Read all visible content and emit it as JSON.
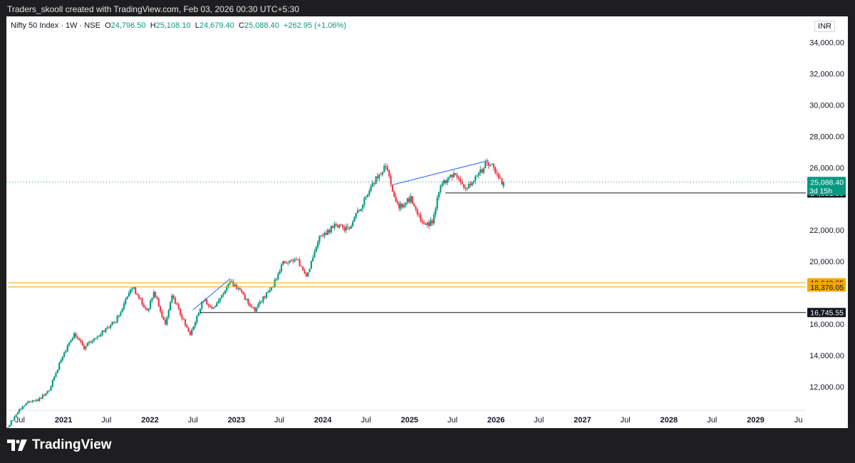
{
  "caption": "Traders_skooll created with TradingView.com, Feb 03, 2026 00:30 UTC+5:30",
  "legend": {
    "symbol": "Nifty 50 Index · 1W · NSE",
    "open_key": "O",
    "open": "24,796.50",
    "high_key": "H",
    "high": "25,108.10",
    "low_key": "L",
    "low": "24,679.40",
    "close_key": "C",
    "close": "25,088.40",
    "change": "+262.95 (+1.06%)"
  },
  "currency": "INR",
  "brand": {
    "name": "TradingView",
    "icon": "tradingview-logo-icon"
  },
  "colors": {
    "up": "#089981",
    "down": "#f23645",
    "trendline": "#2962ff",
    "level_orange": "#f7a600",
    "level_black": "#131722",
    "price_badge": "#089981"
  },
  "chart_data": {
    "type": "candlestick",
    "title": "Nifty 50 Index · 1W · NSE",
    "ylabel": "INR",
    "ylim": [
      10500,
      35200
    ],
    "xlim": [
      "2020-05-11",
      "2029-08-01"
    ],
    "y_ticks": [
      "34,000.00",
      "32,000.00",
      "30,000.00",
      "28,000.00",
      "26,000.00",
      "22,000.00",
      "20,000.00",
      "16,000.00",
      "14,000.00",
      "12,000.00"
    ],
    "y_tick_values": [
      34000,
      32000,
      30000,
      28000,
      26000,
      22000,
      20000,
      16000,
      14000,
      12000
    ],
    "x_ticks": [
      {
        "label": "Jul",
        "date": "2020-07-01",
        "bold": false
      },
      {
        "label": "2021",
        "date": "2021-01-01",
        "bold": true
      },
      {
        "label": "Jul",
        "date": "2021-07-01",
        "bold": false
      },
      {
        "label": "2022",
        "date": "2022-01-01",
        "bold": true
      },
      {
        "label": "Jul",
        "date": "2022-07-01",
        "bold": false
      },
      {
        "label": "2023",
        "date": "2023-01-01",
        "bold": true
      },
      {
        "label": "Jul",
        "date": "2023-07-01",
        "bold": false
      },
      {
        "label": "2024",
        "date": "2024-01-01",
        "bold": true
      },
      {
        "label": "Jul",
        "date": "2024-07-01",
        "bold": false
      },
      {
        "label": "2025",
        "date": "2025-01-01",
        "bold": true
      },
      {
        "label": "Jul",
        "date": "2025-07-01",
        "bold": false
      },
      {
        "label": "2026",
        "date": "2026-01-01",
        "bold": true
      },
      {
        "label": "Jul",
        "date": "2026-07-01",
        "bold": false
      },
      {
        "label": "2027",
        "date": "2027-01-01",
        "bold": true
      },
      {
        "label": "Jul",
        "date": "2027-07-01",
        "bold": false
      },
      {
        "label": "2028",
        "date": "2028-01-01",
        "bold": true
      },
      {
        "label": "Jul",
        "date": "2028-07-01",
        "bold": false
      },
      {
        "label": "2029",
        "date": "2029-01-01",
        "bold": true
      },
      {
        "label": "Ju",
        "date": "2029-07-01",
        "bold": false
      }
    ],
    "last_price": {
      "value": 25088.4,
      "label": "25,088.40",
      "countdown": "3d 15h"
    },
    "levels": [
      {
        "value": 24381.5,
        "label": "24,381.50",
        "color": "#131722",
        "from": "2025-06-01"
      },
      {
        "value": 18640.65,
        "label": "18,640.65",
        "color": "#f7a600",
        "from": "2020-05-11"
      },
      {
        "value": 18376.05,
        "label": "18,376.05",
        "color": "#f7a600",
        "from": "2020-05-11"
      },
      {
        "value": 16745.55,
        "label": "16,745.55",
        "color": "#131722",
        "from": "2022-08-01"
      }
    ],
    "trendlines": [
      {
        "from": [
          "2022-07-01",
          16900
        ],
        "to": [
          "2022-12-05",
          18900
        ]
      },
      {
        "from": [
          "2024-10-21",
          24900
        ],
        "to": [
          "2025-12-01",
          26450
        ]
      }
    ],
    "anchors": [
      [
        "2020-05-11",
        9400
      ],
      [
        "2020-06-15",
        10300
      ],
      [
        "2020-08-03",
        11000
      ],
      [
        "2020-09-21",
        11200
      ],
      [
        "2020-11-02",
        11800
      ],
      [
        "2020-12-28",
        14000
      ],
      [
        "2021-02-15",
        15300
      ],
      [
        "2021-03-29",
        14500
      ],
      [
        "2021-05-10",
        15000
      ],
      [
        "2021-06-28",
        15700
      ],
      [
        "2021-08-09",
        16200
      ],
      [
        "2021-10-18",
        18400
      ],
      [
        "2021-12-20",
        16800
      ],
      [
        "2022-01-17",
        18100
      ],
      [
        "2022-03-07",
        16000
      ],
      [
        "2022-04-04",
        17800
      ],
      [
        "2022-06-20",
        15300
      ],
      [
        "2022-08-15",
        17600
      ],
      [
        "2022-09-26",
        17000
      ],
      [
        "2022-12-05",
        18800
      ],
      [
        "2023-03-20",
        16900
      ],
      [
        "2023-06-12",
        18700
      ],
      [
        "2023-07-17",
        19900
      ],
      [
        "2023-09-11",
        20200
      ],
      [
        "2023-10-23",
        19000
      ],
      [
        "2023-12-11",
        21400
      ],
      [
        "2024-02-19",
        22300
      ],
      [
        "2024-04-15",
        22100
      ],
      [
        "2024-06-03",
        23300
      ],
      [
        "2024-07-29",
        25000
      ],
      [
        "2024-09-23",
        26200
      ],
      [
        "2024-10-21",
        24500
      ],
      [
        "2024-11-18",
        23500
      ],
      [
        "2025-01-06",
        24000
      ],
      [
        "2025-03-03",
        22300
      ],
      [
        "2025-04-07",
        22500
      ],
      [
        "2025-05-12",
        24900
      ],
      [
        "2025-06-30",
        25600
      ],
      [
        "2025-08-18",
        24700
      ],
      [
        "2025-10-06",
        25300
      ],
      [
        "2025-11-24",
        26300
      ],
      [
        "2025-12-22",
        26000
      ],
      [
        "2026-01-26",
        24900
      ]
    ],
    "last_candle": {
      "date": "2026-02-02",
      "open": 24796.5,
      "high": 25108.1,
      "low": 24679.4,
      "close": 25088.4
    }
  }
}
